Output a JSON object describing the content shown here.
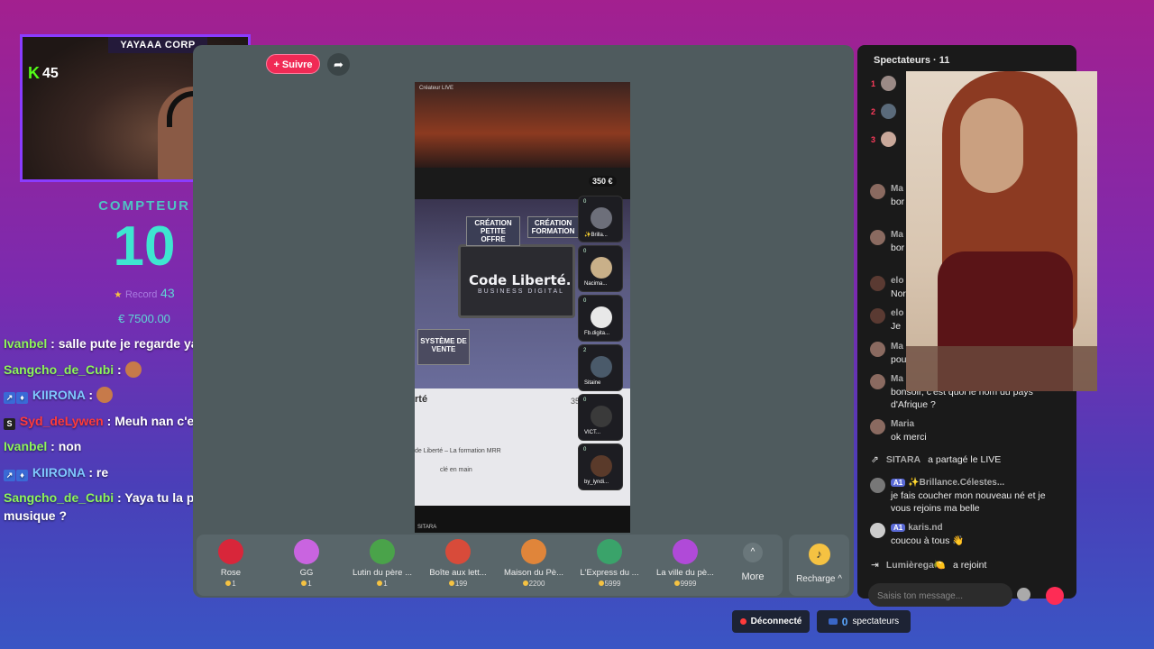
{
  "webcam": {
    "title": "YAYAAA CORP",
    "kick_logo": "K",
    "viewer_count": "45"
  },
  "counter": {
    "label": "COMPTEUR",
    "value": "10",
    "record_label": "Record",
    "record_value": "43",
    "amount": "€ 7500.00"
  },
  "chat": [
    {
      "user": "Ivanbel",
      "color": "green",
      "text": ": salle pute je regarde yaya pas toi sale chienne Aw"
    },
    {
      "user": "Sangcho_de_Cubi",
      "color": "green",
      "text": ":",
      "emote": true
    },
    {
      "user": "KIIRONA",
      "color": "blue",
      "badges": true,
      "text": ":",
      "emote": true
    },
    {
      "user": "Syd_deLywen",
      "color": "red",
      "badge_s": "S",
      "text": ": Meuh nan c'est l'heure de sortir le bangala"
    },
    {
      "user": "Ivanbel",
      "color": "green",
      "text": ": non"
    },
    {
      "user": "KIIRONA",
      "color": "blue",
      "badges": true,
      "text": ": re"
    },
    {
      "user": "Sangcho_de_Cubi",
      "color": "green",
      "text": ": Yaya tu la prendrais en leuleu sur cette musique ?"
    }
  ],
  "stream": {
    "follow_label": "+ Suivre",
    "share_icon": "share-icon",
    "video_brand": "Créateur LIVE",
    "price": "350 €",
    "code_title": "Code Liberté.",
    "code_subtitle": "BUSINESS DIGITAL",
    "tag1": "CRÉATION PETITE OFFRE",
    "tag2": "CRÉATION FORMATION",
    "tag3": "SYSTÈME DE VENTE",
    "white_heading": "rté",
    "white_line1": "de Liberté – La formation MRR",
    "white_line2": "clé en main",
    "white_price": "35",
    "watermark": "SITARA",
    "guests": [
      {
        "name": "✨Brilla...",
        "count": "0"
      },
      {
        "name": "Nacima...",
        "count": "0"
      },
      {
        "name": "Fb.digita...",
        "count": "0"
      },
      {
        "name": "Sitaine",
        "count": "2"
      },
      {
        "name": "VICT...",
        "count": "0"
      },
      {
        "name": "by_lyndi...",
        "count": "0"
      }
    ]
  },
  "gifts": [
    {
      "name": "Rose",
      "price": "1",
      "color": "#d8263a"
    },
    {
      "name": "GG",
      "price": "1",
      "color": "#c964e0"
    },
    {
      "name": "Lutin du père ...",
      "price": "1",
      "color": "#4aa34a"
    },
    {
      "name": "Boîte aux lett...",
      "price": "199",
      "color": "#d84b3a"
    },
    {
      "name": "Maison du Pè...",
      "price": "2200",
      "color": "#e0853a"
    },
    {
      "name": "L'Express du ...",
      "price": "5999",
      "color": "#3aa36a"
    },
    {
      "name": "La ville du pè...",
      "price": "9999",
      "color": "#b04ad8"
    }
  ],
  "more_label": "More",
  "recharge_label": "Recharge ^",
  "side": {
    "title": "Spectateurs · 11",
    "ranks": [
      "1",
      "2",
      "3"
    ],
    "comments": [
      {
        "name": "Ma",
        "text": "bor d'A"
      },
      {
        "name": "Ma",
        "text": "bor d'A"
      },
      {
        "name": "elo",
        "text": "Nor"
      },
      {
        "name": "elo",
        "text": "Je"
      },
      {
        "name": "Ma",
        "text": "pou"
      },
      {
        "name": "Ma",
        "text": "bonsoir, c'est quoi le nom du pays d'Afrique ?"
      },
      {
        "name": "Maria",
        "text": "ok merci"
      }
    ],
    "shared": {
      "user": "SITARA",
      "text": "a partagé le LIVE"
    },
    "brillance": {
      "level": "A1",
      "name": "✨Brillance.Célestes...",
      "text": "je fais coucher mon nouveau né et je vous rejoins ma belle"
    },
    "karis": {
      "level": "A1",
      "name": "karis.nd",
      "text": "coucou à tous 👋"
    },
    "joined": {
      "user": "Lumièrеga🍋",
      "text": "a rejoint"
    },
    "input_placeholder": "Saisis ton message..."
  },
  "status": {
    "disconnected": "Déconnecté",
    "viewers_count": "0",
    "viewers_label": "spectateurs"
  }
}
